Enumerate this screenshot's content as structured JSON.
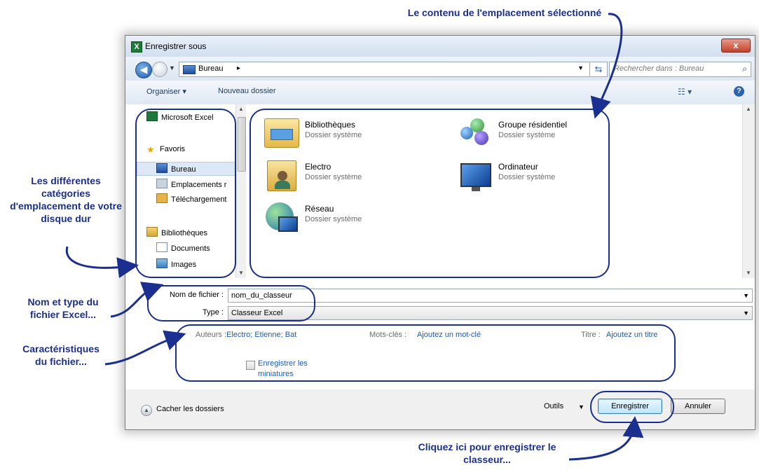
{
  "annotations": {
    "top": "Le contenu de l'emplacement sélectionné",
    "left_categories": "Les différentes catégories d'emplacement de votre disque dur",
    "left_filename": "Nom et type du fichier Excel...",
    "left_properties": "Caractéristiques du fichier...",
    "bottom": "Cliquez ici pour enregistrer le classeur..."
  },
  "window": {
    "title": "Enregistrer sous",
    "close_glyph": "x"
  },
  "address": {
    "location": "Bureau",
    "search_placeholder": "Rechercher dans : Bureau"
  },
  "toolbar": {
    "organize_label": "Organiser ▾",
    "new_folder_label": "Nouveau dossier"
  },
  "nav": {
    "items": [
      {
        "label": "Microsoft Excel",
        "icon": "excel-icon"
      },
      {
        "label": "Favoris",
        "icon": "star-icon"
      },
      {
        "label": "Bureau",
        "icon": "desktop-icon"
      },
      {
        "label": "Emplacements r",
        "icon": "recent-places-icon"
      },
      {
        "label": "Téléchargement",
        "icon": "downloads-icon"
      },
      {
        "label": "Bibliothèques",
        "icon": "libraries-icon"
      },
      {
        "label": "Documents",
        "icon": "documents-icon"
      },
      {
        "label": "Images",
        "icon": "images-icon"
      }
    ]
  },
  "content": {
    "items": [
      {
        "name": "Bibliothèques",
        "sub": "Dossier système",
        "icon": "libraries-folder-icon"
      },
      {
        "name": "Groupe résidentiel",
        "sub": "Dossier système",
        "icon": "homegroup-icon"
      },
      {
        "name": "Electro",
        "sub": "Dossier système",
        "icon": "user-folder-icon"
      },
      {
        "name": "Ordinateur",
        "sub": "Dossier système",
        "icon": "computer-icon"
      },
      {
        "name": "Réseau",
        "sub": "Dossier système",
        "icon": "network-icon"
      }
    ]
  },
  "form": {
    "filename_label": "Nom de fichier :",
    "filename_value": "nom_du_classeur",
    "type_label": "Type :",
    "type_value": "Classeur Excel"
  },
  "meta": {
    "authors_label": "Auteurs :",
    "authors_value": "Electro; Etienne; Bat",
    "keywords_label": "Mots-clés :",
    "keywords_value": "Ajoutez un mot-clé",
    "title_label": "Titre :",
    "title_value": "Ajoutez un titre",
    "thumbnails_label_1": "Enregistrer les",
    "thumbnails_label_2": "miniatures"
  },
  "footer": {
    "hide_folders_label": "Cacher les dossiers",
    "tools_label": "Outils",
    "save_label": "Enregistrer",
    "cancel_label": "Annuler"
  },
  "colors": {
    "annotation": "#1a2f8f",
    "link": "#1e5bb5"
  }
}
